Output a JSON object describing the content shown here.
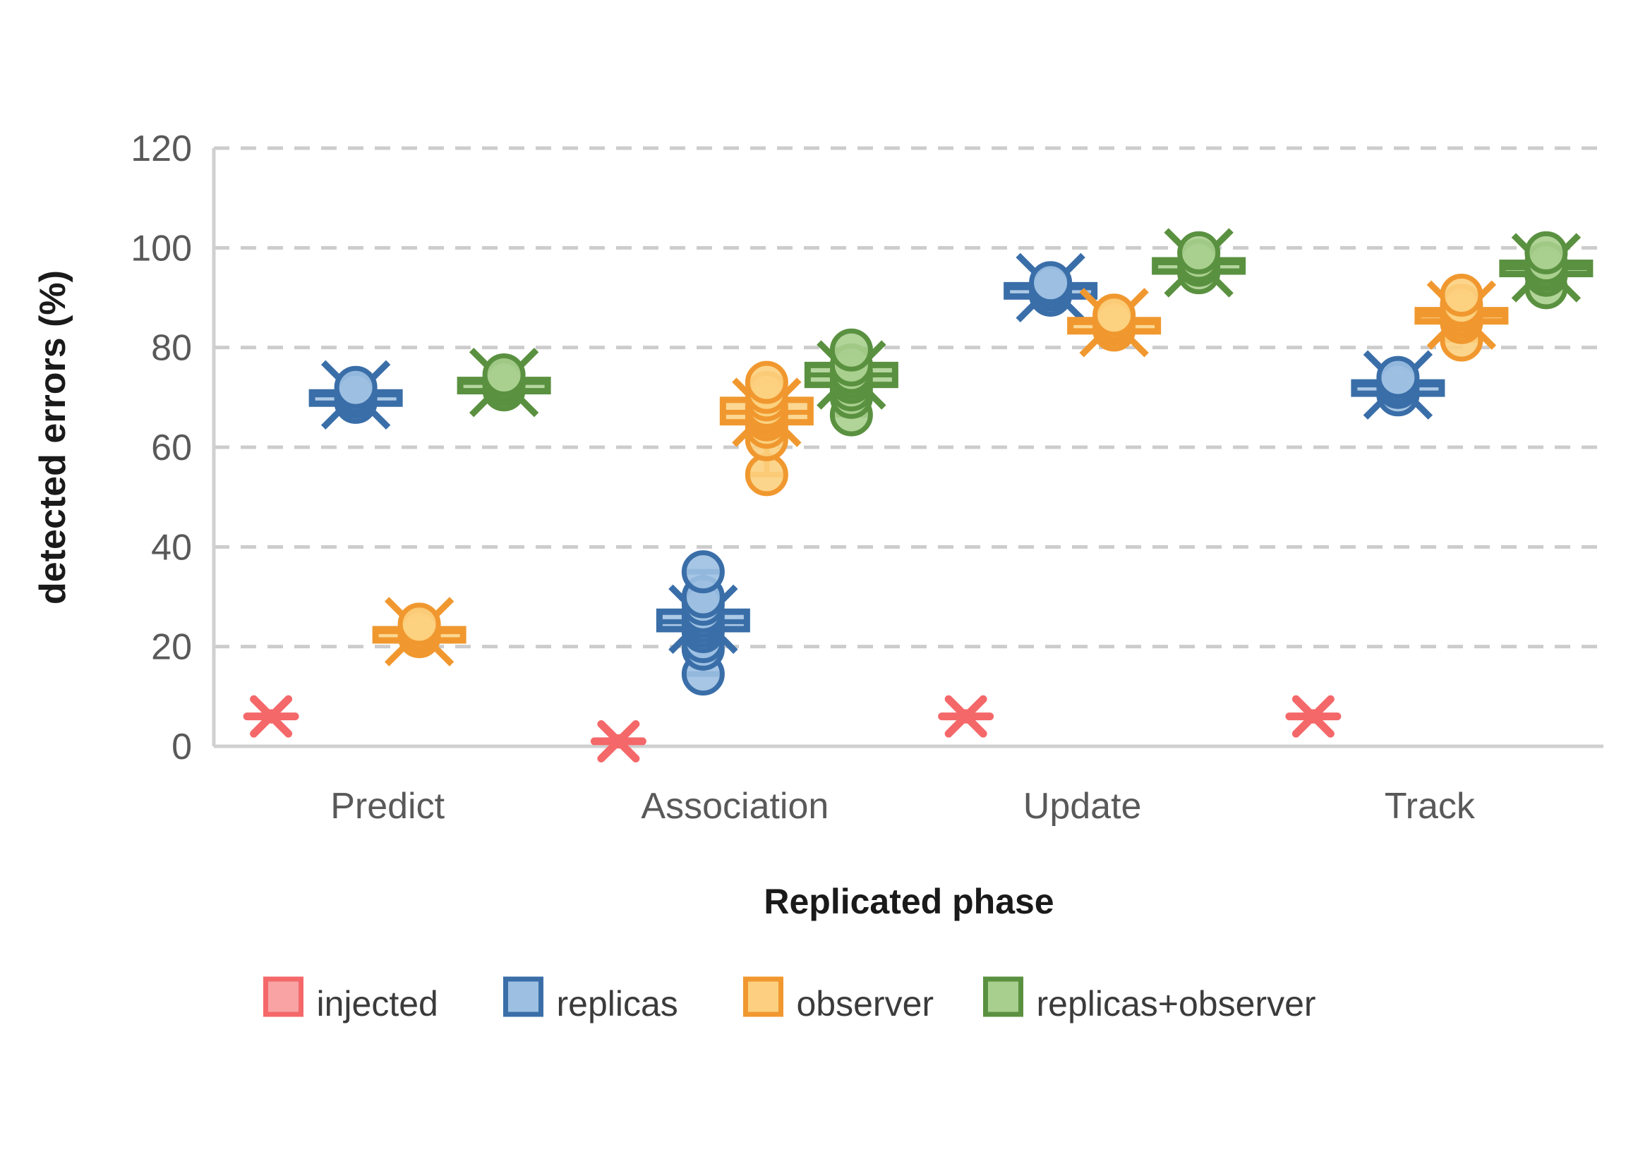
{
  "chart_data": {
    "type": "box",
    "title": "",
    "xlabel": "Replicated phase",
    "ylabel": "detected errors (%)",
    "ylim": [
      0,
      120
    ],
    "ytick_step": 20,
    "yticks": [
      "0",
      "20",
      "40",
      "60",
      "80",
      "100",
      "120"
    ],
    "categories": [
      "Predict",
      "Association",
      "Update",
      "Track"
    ],
    "grid": "horizontal-dashed",
    "legend_position": "bottom",
    "series": [
      {
        "name": "injected",
        "color": "#f4686a",
        "fill": "#f9a3a4",
        "marker": "cross-x",
        "values": [
          6,
          1,
          6,
          6
        ]
      },
      {
        "name": "replicas",
        "color": "#3a6ea8",
        "fill": "#9dc0e2",
        "marker": "box",
        "values": [
          70.5,
          25,
          92,
          72
        ],
        "boxes": [
          {
            "category": "Predict",
            "min": 69,
            "q1": 70,
            "median": 70.5,
            "mean": 70.5,
            "q3": 71,
            "max": 72,
            "points": [
              69,
              70,
              70.5,
              71,
              72
            ]
          },
          {
            "category": "Association",
            "min": 14.5,
            "q1": 23.5,
            "median": 25,
            "mean": 25.5,
            "q3": 27,
            "max": 35,
            "points": [
              14.5,
              19.5,
              21,
              23,
              24,
              25,
              26,
              27,
              28.5,
              30,
              35
            ]
          },
          {
            "category": "Update",
            "min": 90.5,
            "q1": 91.5,
            "median": 92,
            "mean": 92,
            "q3": 92.5,
            "max": 93,
            "points": [
              90.5,
              91.5,
              92,
              92.5,
              93
            ]
          },
          {
            "category": "Track",
            "min": 70.5,
            "q1": 72,
            "median": 72.5,
            "mean": 72.5,
            "q3": 73,
            "max": 74,
            "points": [
              70.5,
              72,
              72.5,
              73,
              74
            ]
          }
        ]
      },
      {
        "name": "observer",
        "color": "#f0982f",
        "fill": "#fcd080",
        "marker": "box",
        "values": [
          23,
          67,
          85,
          86.5
        ],
        "boxes": [
          {
            "category": "Predict",
            "min": 22,
            "q1": 22.5,
            "median": 23,
            "mean": 23,
            "q3": 23.5,
            "max": 24.5,
            "points": [
              22,
              22.5,
              23,
              23.5,
              24.5
            ]
          },
          {
            "category": "Association",
            "min": 54.5,
            "q1": 65,
            "median": 67,
            "mean": 67,
            "q3": 69.5,
            "max": 73,
            "points": [
              54.5,
              61.5,
              64,
              65.5,
              66.5,
              67,
              68,
              69.5,
              71,
              73
            ]
          },
          {
            "category": "Update",
            "min": 83.5,
            "q1": 84.5,
            "median": 85,
            "mean": 85,
            "q3": 85.5,
            "max": 86.5,
            "points": [
              83.5,
              84.5,
              85,
              85.5,
              86.5
            ]
          },
          {
            "category": "Track",
            "min": 81.5,
            "q1": 85.5,
            "median": 86.5,
            "mean": 86.5,
            "q3": 87.5,
            "max": 90.5,
            "points": [
              81.5,
              85,
              86,
              86.5,
              87.5,
              88.5,
              90.5
            ]
          }
        ]
      },
      {
        "name": "replicas+observer",
        "color": "#5a9140",
        "fill": "#a8cf8e",
        "marker": "box",
        "values": [
          73,
          74.5,
          97,
          96
        ],
        "boxes": [
          {
            "category": "Predict",
            "min": 71.5,
            "q1": 72.5,
            "median": 73,
            "mean": 73,
            "q3": 73.5,
            "max": 74.5,
            "points": [
              71.5,
              72.5,
              73,
              73.5,
              74.5
            ]
          },
          {
            "category": "Association",
            "min": 66.5,
            "q1": 72.5,
            "median": 74.5,
            "mean": 74.5,
            "q3": 76.5,
            "max": 79.5,
            "points": [
              66.5,
              70,
              71.5,
              73,
              74,
              75,
              76.5,
              79.5
            ]
          },
          {
            "category": "Update",
            "min": 95,
            "q1": 96.5,
            "median": 97,
            "mean": 97,
            "q3": 97.5,
            "max": 99,
            "points": [
              95,
              96.5,
              97,
              97.5,
              99
            ]
          },
          {
            "category": "Track",
            "min": 92,
            "q1": 95,
            "median": 96,
            "mean": 96,
            "q3": 97,
            "max": 99,
            "points": [
              92,
              94.5,
              95.5,
              96,
              97,
              99
            ]
          }
        ]
      }
    ]
  },
  "axis": {
    "ylabel": "detected errors (%)",
    "xlabel": "Replicated phase",
    "ytick_0": "0",
    "ytick_20": "20",
    "ytick_40": "40",
    "ytick_60": "60",
    "ytick_80": "80",
    "ytick_100": "100",
    "ytick_120": "120",
    "cat_0": "Predict",
    "cat_1": "Association",
    "cat_2": "Update",
    "cat_3": "Track"
  },
  "legend": {
    "items": [
      {
        "label": "injected",
        "color": "#f9a3a4",
        "stroke": "#f4686a"
      },
      {
        "label": "replicas",
        "color": "#9dc0e2",
        "stroke": "#3a6ea8"
      },
      {
        "label": "observer",
        "color": "#fcd080",
        "stroke": "#f0982f"
      },
      {
        "label": "replicas+observer",
        "color": "#a8cf8e",
        "stroke": "#5a9140"
      }
    ]
  }
}
